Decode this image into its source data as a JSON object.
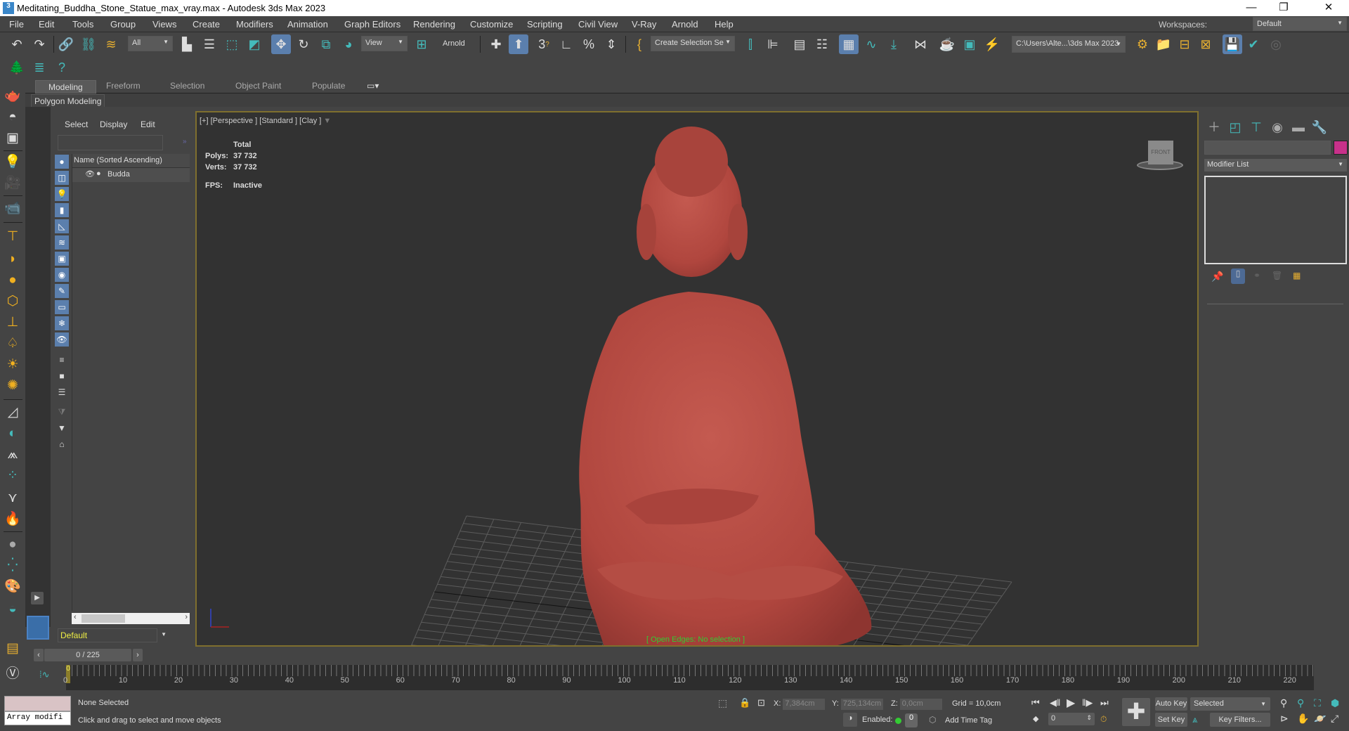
{
  "window": {
    "app_icon": "3ds-max-icon",
    "title": "Meditating_Buddha_Stone_Statue_max_vray.max - Autodesk 3ds Max 2023",
    "minimize": "—",
    "restore": "❐",
    "close": "✕"
  },
  "menu": {
    "items": [
      "File",
      "Edit",
      "Tools",
      "Group",
      "Views",
      "Create",
      "Modifiers",
      "Animation",
      "Graph Editors",
      "Rendering",
      "Customize",
      "Scripting",
      "Civil View",
      "V-Ray",
      "Arnold",
      "Help"
    ],
    "workspaces_label": "Workspaces:",
    "workspaces_value": "Default"
  },
  "toolbar": {
    "selection_filter": "All",
    "ref_coord": "View",
    "arnold_label": "Arnold",
    "named_selection": "Create Selection Se",
    "project_path": "C:\\Users\\Alte...\\3ds Max 2023"
  },
  "ribbon": {
    "tabs": [
      "Modeling",
      "Freeform",
      "Selection",
      "Object Paint",
      "Populate"
    ],
    "active_tab": "Modeling",
    "panel": "Polygon Modeling"
  },
  "explorer": {
    "menus": [
      "Select",
      "Display",
      "Edit"
    ],
    "search_placeholder": "",
    "column_header": "Name (Sorted Ascending)",
    "rows": [
      {
        "name": "Budda"
      }
    ],
    "layer": "Default"
  },
  "viewport": {
    "label": "[+] [Perspective ] [Standard ] [Clay ]",
    "stats": {
      "total_label": "Total",
      "polys_label": "Polys:",
      "polys": "37 732",
      "verts_label": "Verts:",
      "verts": "37 732",
      "fps_label": "FPS:",
      "fps": "Inactive"
    },
    "viewcube_label": "FRONT",
    "status": "[ Open Edges: No selection ]",
    "statue_color": "#b5483f",
    "border_color": "#7f6f2e"
  },
  "command_panel": {
    "modifier_list": "Modifier List",
    "object_color": "#c8318a"
  },
  "timeline": {
    "frame_display": "0 / 225",
    "current_frame": 0,
    "total_frames": 225,
    "tick_labels": [
      0,
      10,
      20,
      30,
      40,
      50,
      60,
      70,
      80,
      90,
      100,
      110,
      120,
      130,
      140,
      150,
      160,
      170,
      180,
      190,
      200,
      210,
      220
    ]
  },
  "status": {
    "maxscript_text": "Array modifi",
    "selection": "None Selected",
    "prompt": "Click and drag to select and move objects",
    "x_label": "X:",
    "x": "7,384cm",
    "y_label": "Y:",
    "y": "725,134cm",
    "z_label": "Z:",
    "z": "0,0cm",
    "grid": "Grid = 10,0cm",
    "enabled_label": "Enabled:",
    "add_time_tag": "Add Time Tag",
    "frame_field": "0",
    "auto_key": "Auto Key",
    "set_key": "Set Key",
    "key_mode": "Selected",
    "key_filters": "Key Filters..."
  }
}
